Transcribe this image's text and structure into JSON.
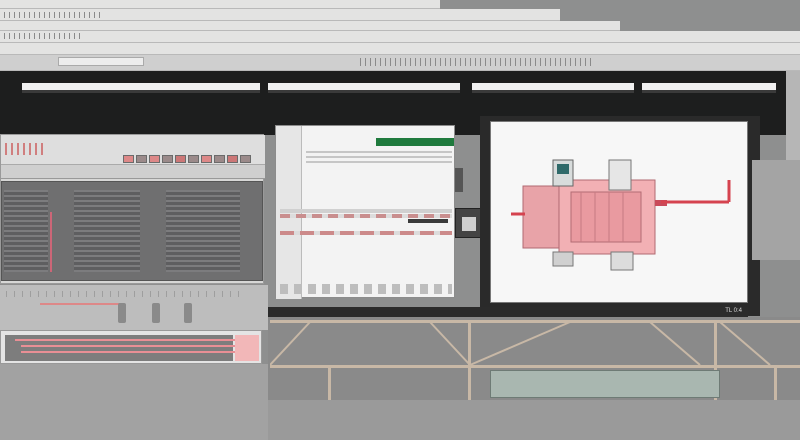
{
  "statusbar": {
    "text": "TL 0:4"
  },
  "colors": {
    "accent_red": "#e88f95",
    "accent_green": "#1f7a3d",
    "band": "#1d1e1e"
  },
  "icons": [
    "pump-diagram-icon",
    "panel-indicator-icon",
    "rack-icon"
  ]
}
